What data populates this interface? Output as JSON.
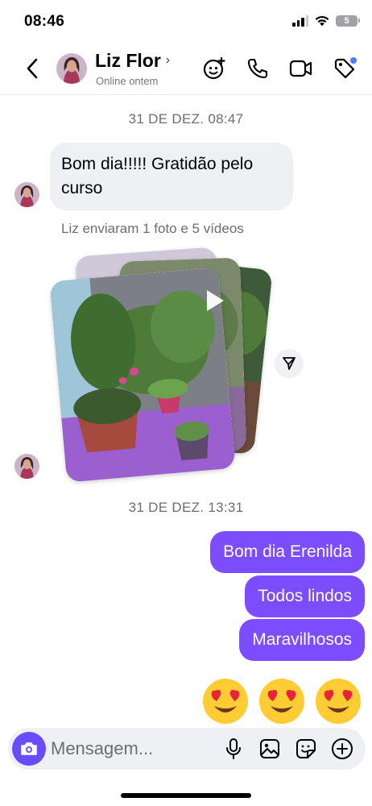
{
  "status_bar": {
    "time": "08:46",
    "battery": "5"
  },
  "header": {
    "contact_name": "Liz Flor",
    "contact_status": "Online ontem",
    "icons": [
      "back-icon",
      "effects-icon",
      "phone-icon",
      "video-icon",
      "tag-icon"
    ]
  },
  "chat": {
    "timestamp_1": "31 DE DEZ. 08:47",
    "incoming_message": "Bom dia!!!!! Gratidão pelo curso",
    "media_info": "Liz enviaram 1 foto e 5 vídeos",
    "timestamp_2": "31 DE DEZ. 13:31",
    "outgoing_messages": [
      "Bom dia Erenilda",
      "Todos lindos",
      "Maravilhosos"
    ],
    "emojis": [
      "😍",
      "😍",
      "😍"
    ]
  },
  "composer": {
    "placeholder": "Mensagem..."
  },
  "colors": {
    "accent": "#7c4dff",
    "incoming_bubble": "#eff0f4",
    "timestamp_text": "#6d6d72"
  }
}
